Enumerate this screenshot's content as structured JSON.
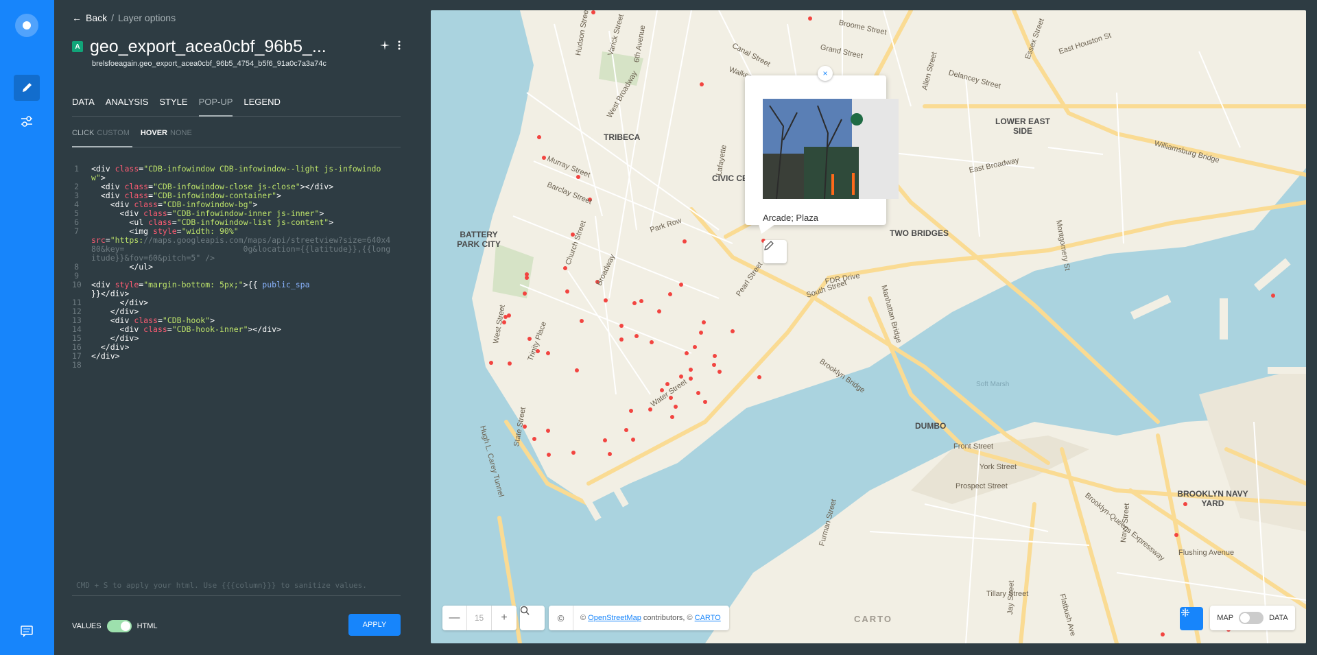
{
  "nav": {
    "icons": [
      "carto-logo-icon",
      "pencil-icon",
      "sliders-icon",
      "chat-icon"
    ]
  },
  "editor": {
    "back_label": "Back",
    "breadcrumb_sep": "/",
    "breadcrumb_current": "Layer options",
    "layer_letter": "A",
    "layer_title": "geo_export_acea0cbf_96b5_...",
    "layer_subtitle": "brelsfoeagain.geo_export_acea0cbf_96b5_4754_b5f6_91a0c7a3a74c",
    "tabs": [
      "DATA",
      "ANALYSIS",
      "STYLE",
      "POP-UP",
      "LEGEND"
    ],
    "active_tab": "POP-UP",
    "subtabs": [
      {
        "key": "CLICK",
        "value": "CUSTOM"
      },
      {
        "key": "HOVER",
        "value": "NONE"
      }
    ],
    "code_hint": "CMD + S to apply your html. Use {{{column}}} to sanitize values.",
    "values_label": "VALUES",
    "html_label": "HTML",
    "apply_label": "APPLY"
  },
  "map": {
    "popup_text": "Arcade; Plaza",
    "popup_close": "×",
    "zoom_minus": "—",
    "zoom_level": "15",
    "zoom_plus": "+",
    "attribution_prefix": "©",
    "attribution_text_1": "© ",
    "osm_link": "OpenStreetMap",
    "attribution_text_2": " contributors, © ",
    "carto_link": "CARTO",
    "carto_logo": "CARTO",
    "map_label": "MAP",
    "data_label": "DATA",
    "neighborhoods": [
      "TRIBECA",
      "LOWER EAST SIDE",
      "TWO BRIDGES",
      "BATTERY PARK CITY",
      "CIVIC CE",
      "DUMBO",
      "BROOKLYN NAVY YARD"
    ],
    "streets": [
      "Canal Street",
      "Grand Street",
      "Broome Street",
      "Delancey Street",
      "East Houston St",
      "Williamsburg Bridge",
      "East Broadway",
      "Murray Street",
      "Barclay Street",
      "Park Row",
      "Church Street",
      "Broadway",
      "Pearl Street",
      "South Street",
      "FDR Drive",
      "Manhattan Bridge",
      "Brooklyn Bridge",
      "Water Street",
      "Front Street",
      "York Street",
      "Prospect Street",
      "Brooklyn-Queens Expressway",
      "Flushing Avenue",
      "Tillary Street",
      "Navy Street",
      "Furman Street",
      "Trinity Place",
      "West Street",
      "Hudson Street",
      "Varick Street",
      "6th Avenue",
      "West Broadway",
      "Walker Street",
      "Lafayette",
      "Allen Street",
      "Essex Street",
      "Montgomery St",
      "Hugh L. Carey Tunnel",
      "State Street",
      "Soft Marsh",
      "Jay Street",
      "Flatbush Ave"
    ]
  }
}
